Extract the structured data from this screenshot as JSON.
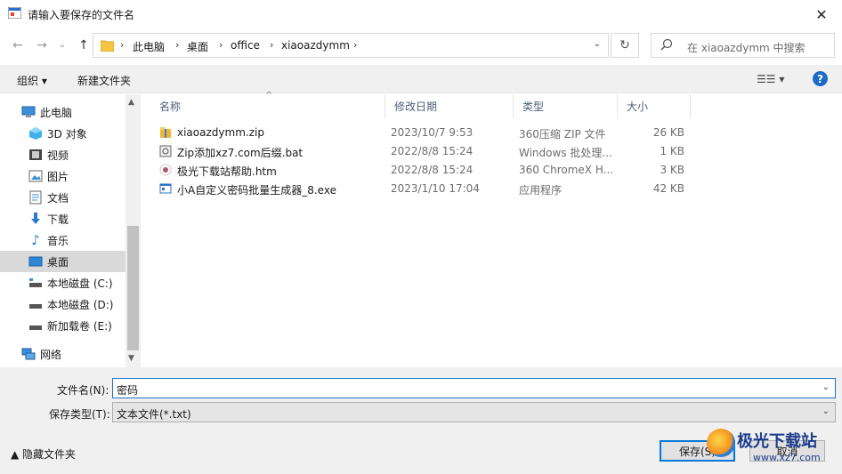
{
  "window": {
    "title": "请输入要保存的文件名",
    "close_glyph": "✕"
  },
  "nav": {
    "back_glyph": "←",
    "forward_glyph": "→",
    "recent_glyph": "⌄",
    "up_glyph": "↑",
    "breadcrumb": [
      "此电脑",
      "桌面",
      "office",
      "xiaoazdymm"
    ],
    "sep": "›",
    "refresh_glyph": "↻",
    "search_placeholder": "在 xiaoazdymm 中搜索"
  },
  "toolbar": {
    "organize": "组织 ▾",
    "new_folder": "新建文件夹",
    "view": "☰☰ ▾",
    "help": "?"
  },
  "sidebar": {
    "items": [
      {
        "label": "此电脑",
        "icon": "computer-icon",
        "glyph": "🖥"
      },
      {
        "label": "3D 对象",
        "icon": "3d-objects-icon",
        "glyph": "◆"
      },
      {
        "label": "视频",
        "icon": "video-icon",
        "glyph": "▤"
      },
      {
        "label": "图片",
        "icon": "pictures-icon",
        "glyph": "▨"
      },
      {
        "label": "文档",
        "icon": "documents-icon",
        "glyph": "▤"
      },
      {
        "label": "下载",
        "icon": "download-icon",
        "glyph": "⬇"
      },
      {
        "label": "音乐",
        "icon": "music-icon",
        "glyph": "♪"
      },
      {
        "label": "桌面",
        "icon": "desktop-icon",
        "glyph": "▭"
      },
      {
        "label": "本地磁盘 (C:)",
        "icon": "drive-icon",
        "glyph": "▬"
      },
      {
        "label": "本地磁盘 (D:)",
        "icon": "drive-icon",
        "glyph": "▬"
      },
      {
        "label": "新加载卷 (E:)",
        "icon": "drive-icon",
        "glyph": "▬"
      },
      {
        "label": "网络",
        "icon": "network-icon",
        "glyph": "🖧"
      }
    ],
    "selected": "桌面"
  },
  "columns": {
    "name": "名称",
    "date": "修改日期",
    "type": "类型",
    "size": "大小"
  },
  "files": [
    {
      "name": "xiaoazdymm.zip",
      "date": "2023/10/7 9:53",
      "type": "360压缩 ZIP 文件",
      "size": "26 KB",
      "icon": "zip-icon"
    },
    {
      "name": "Zip添加xz7.com后缀.bat",
      "date": "2022/8/8 15:24",
      "type": "Windows 批处理...",
      "size": "1 KB",
      "icon": "bat-icon"
    },
    {
      "name": "极光下载站帮助.htm",
      "date": "2022/8/8 15:24",
      "type": "360 ChromeX H...",
      "size": "3 KB",
      "icon": "htm-icon"
    },
    {
      "name": "小A自定义密码批量生成器_8.exe",
      "date": "2023/1/10 17:04",
      "type": "应用程序",
      "size": "42 KB",
      "icon": "exe-icon"
    }
  ],
  "form": {
    "filename_label": "文件名(N):",
    "filename_value": "密码",
    "filetype_label": "保存类型(T):",
    "filetype_value": "文本文件(*.txt)",
    "dropdown_glyph": "⌄"
  },
  "footer": {
    "hide_folders": "▲  隐藏文件夹",
    "save": "保存(S)",
    "cancel": "取消"
  },
  "watermark": {
    "name": "极光下载站",
    "url": "www.xz7.com"
  }
}
